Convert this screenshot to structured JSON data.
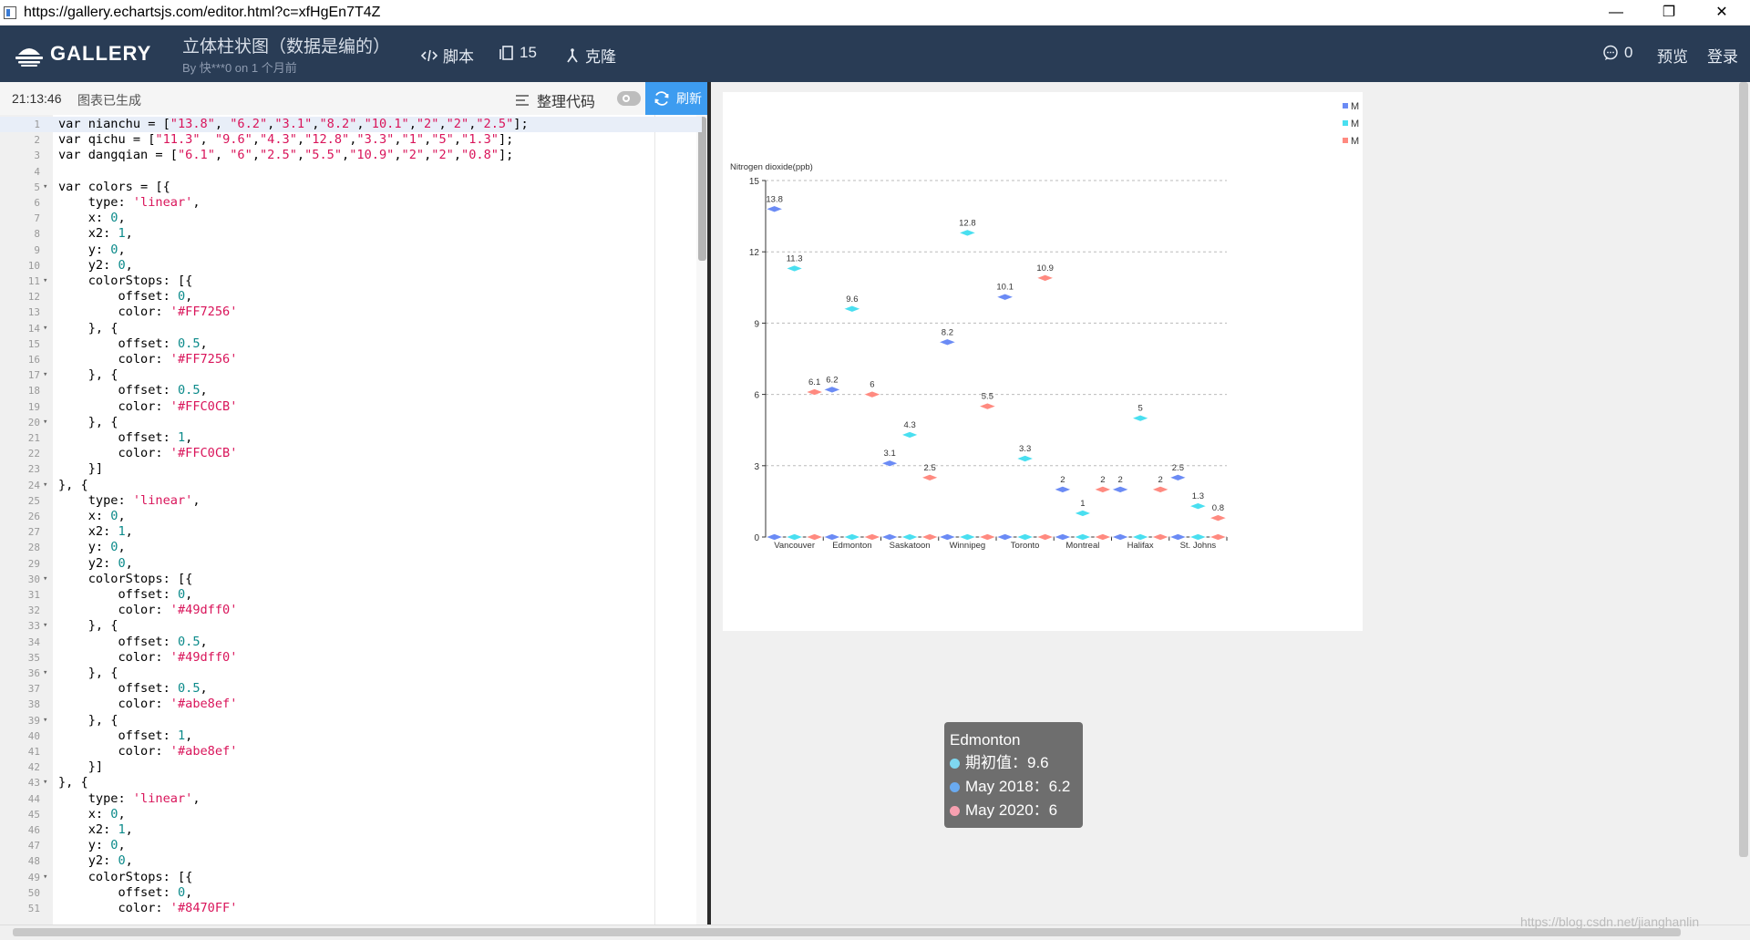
{
  "browser": {
    "url": "https://gallery.echartsjs.com/editor.html?c=xfHgEn7T4Z",
    "minimize_glyph": "—",
    "restore_glyph": "❐",
    "close_glyph": "✕"
  },
  "header": {
    "logo_text": "GALLERY",
    "title": "立体柱状图（数据是编的）",
    "author": "By 快***0 on 1 个月前",
    "script_label": "脚本",
    "forks_count": "15",
    "clone_label": "克隆",
    "comments_count": "0",
    "preview_label": "预览",
    "login_label": "登录"
  },
  "toolbar": {
    "time": "21:13:46",
    "status": "图表已生成",
    "format_label": "整理代码",
    "refresh_label": "刷新"
  },
  "editor": {
    "lines": [
      "var nianchu = [\"13.8\", \"6.2\",\"3.1\",\"8.2\",\"10.1\",\"2\",\"2\",\"2.5\"];",
      "var qichu = [\"11.3\", \"9.6\",\"4.3\",\"12.8\",\"3.3\",\"1\",\"5\",\"1.3\"];",
      "var dangqian = [\"6.1\", \"6\",\"2.5\",\"5.5\",\"10.9\",\"2\",\"2\",\"0.8\"];",
      "",
      "var colors = [{",
      "    type: 'linear',",
      "    x: 0,",
      "    x2: 1,",
      "    y: 0,",
      "    y2: 0,",
      "    colorStops: [{",
      "        offset: 0,",
      "        color: '#FF7256'",
      "    }, {",
      "        offset: 0.5,",
      "        color: '#FF7256'",
      "    }, {",
      "        offset: 0.5,",
      "        color: '#FFC0CB'",
      "    }, {",
      "        offset: 1,",
      "        color: '#FFC0CB'",
      "    }]",
      "}, {",
      "    type: 'linear',",
      "    x: 0,",
      "    x2: 1,",
      "    y: 0,",
      "    y2: 0,",
      "    colorStops: [{",
      "        offset: 0,",
      "        color: '#49dff0'",
      "    }, {",
      "        offset: 0.5,",
      "        color: '#49dff0'",
      "    }, {",
      "        offset: 0.5,",
      "        color: '#abe8ef'",
      "    }, {",
      "        offset: 1,",
      "        color: '#abe8ef'",
      "    }]",
      "}, {",
      "    type: 'linear',",
      "    x: 0,",
      "    x2: 1,",
      "    y: 0,",
      "    y2: 0,",
      "    colorStops: [{",
      "        offset: 0,",
      "        color: '#8470FF'"
    ],
    "fold_lines": [
      5,
      11,
      14,
      17,
      20,
      24,
      30,
      33,
      36,
      39,
      43,
      49
    ]
  },
  "chart_data": {
    "type": "scatter",
    "ylabel": "Nitrogen dioxide(ppb)",
    "categories": [
      "Vancouver",
      "Edmonton",
      "Saskatoon",
      "Winnipeg",
      "Toronto",
      "Montreal",
      "Halifax",
      "St. Johns"
    ],
    "ylim": [
      0,
      15
    ],
    "yticks": [
      "0",
      "3",
      "6",
      "9",
      "12",
      "15"
    ],
    "grid": true,
    "legend_position": "top-right",
    "series": [
      {
        "name": "M",
        "color": "#6b8bf5",
        "values": [
          13.8,
          6.2,
          3.1,
          8.2,
          10.1,
          2,
          2,
          2.5
        ]
      },
      {
        "name": "M",
        "color": "#49dff0",
        "values": [
          11.3,
          9.6,
          4.3,
          12.8,
          3.3,
          1,
          5,
          1.3
        ]
      },
      {
        "name": "M",
        "color": "#ff8a80",
        "values": [
          6.1,
          6,
          2.5,
          5.5,
          10.9,
          2,
          2,
          0.8
        ]
      }
    ]
  },
  "tooltip": {
    "title": "Edmonton",
    "rows": [
      {
        "label": "期初值：9.6",
        "color": "#7fd8f0"
      },
      {
        "label": "May 2018：6.2",
        "color": "#6aaaf0"
      },
      {
        "label": "May 2020：6",
        "color": "#f7a0b0"
      }
    ]
  },
  "watermark": "https://blog.csdn.net/jianghanlin"
}
